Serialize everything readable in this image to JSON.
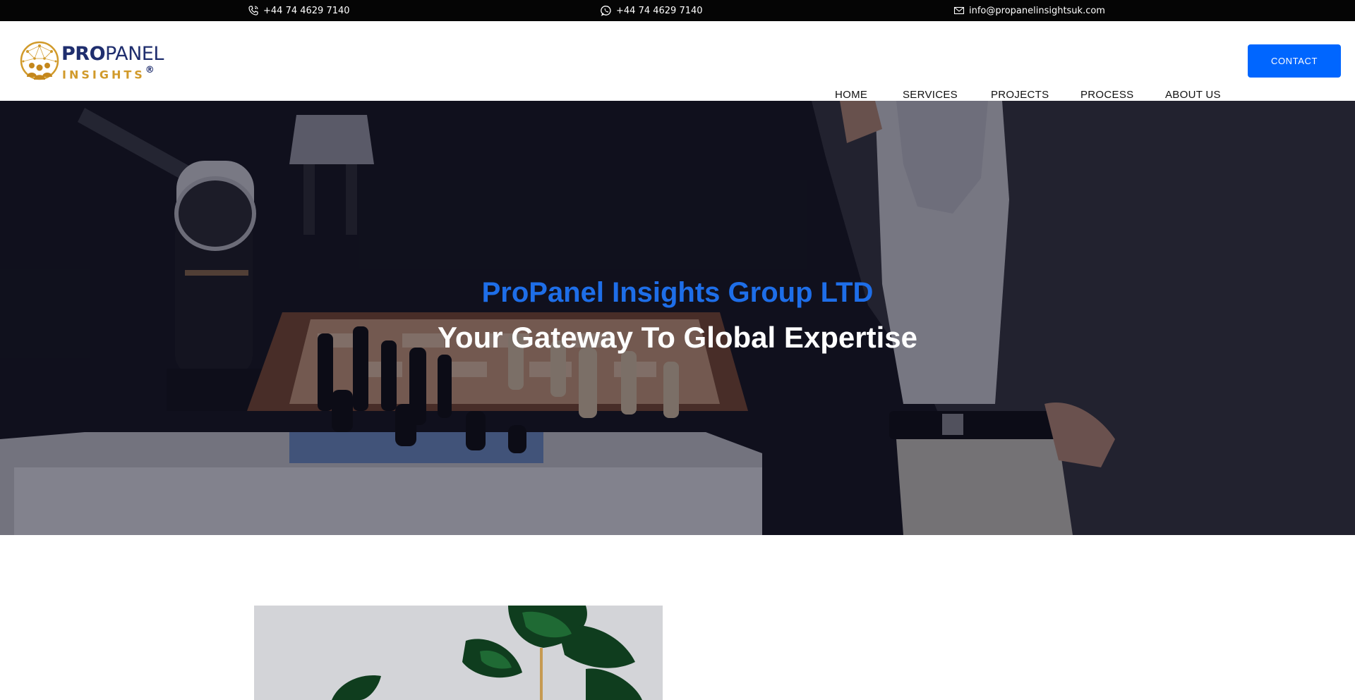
{
  "topbar": {
    "phone": "+44 74 4629 7140",
    "whatsapp": "+44 74 4629 7140",
    "email": "info@propanelinsightsuk.com",
    "icons": [
      "phone-icon",
      "whatsapp-icon",
      "mail-icon"
    ]
  },
  "logo": {
    "word_bold": "PRO",
    "word_light": "PANEL",
    "sub": "INSIGHTS",
    "registered": "®",
    "colors": {
      "navy": "#1f2e6e",
      "gold": "#d19a2a"
    }
  },
  "nav": {
    "items": [
      "HOME",
      "SERVICES",
      "PROJECTS",
      "PROCESS",
      "ABOUT US"
    ],
    "contact": "CONTACT",
    "accent": "#0066ff"
  },
  "hero": {
    "title": "ProPanel Insights Group LTD",
    "subtitle": "Your Gateway To Global Expertise",
    "title_color": "#1e6ee8"
  }
}
